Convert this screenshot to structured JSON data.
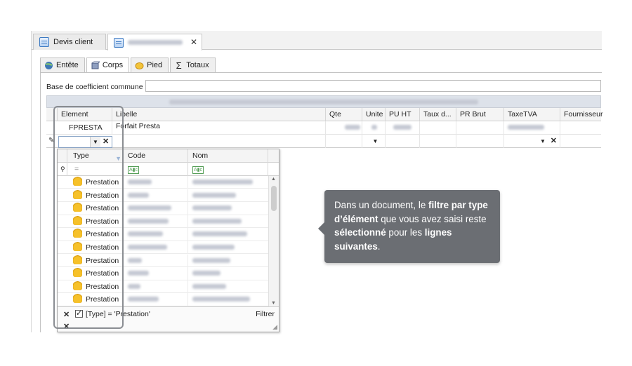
{
  "doc_tabs": [
    {
      "label": "Devis client"
    },
    {
      "label": ""
    }
  ],
  "inner_tabs": [
    {
      "label": "Entête",
      "icon": "globe-icon"
    },
    {
      "label": "Corps",
      "icon": "cube-icon"
    },
    {
      "label": "Pied",
      "icon": "smiley-icon"
    },
    {
      "label": "Totaux",
      "icon": "sigma-icon"
    }
  ],
  "coefficient": {
    "label": "Base de coefficient commune :",
    "value": ""
  },
  "grid": {
    "columns": [
      "Element",
      "Libelle",
      "Qte",
      "Unite",
      "PU HT",
      "Taux d...",
      "PR Brut",
      "TaxeTVA",
      "Fournisseur"
    ],
    "row1": {
      "element": "FPRESTA",
      "libelle": "Forfait Presta"
    }
  },
  "popup": {
    "columns": [
      "Type",
      "Code",
      "Nom"
    ],
    "rows": [
      "Prestation",
      "Prestation",
      "Prestation",
      "Prestation",
      "Prestation",
      "Prestation",
      "Prestation",
      "Prestation",
      "Prestation",
      "Prestation"
    ],
    "filter_expression": "[Type] = 'Prestation'",
    "filter_button": "Filtrer"
  },
  "callout": {
    "t1": "Dans un document, le ",
    "b1": "filtre par type d’élément",
    "t2": " que vous avez saisi reste ",
    "b2": "sélectionné",
    "t3": " pour les ",
    "b3": "lignes suivantes",
    "t4": "."
  }
}
